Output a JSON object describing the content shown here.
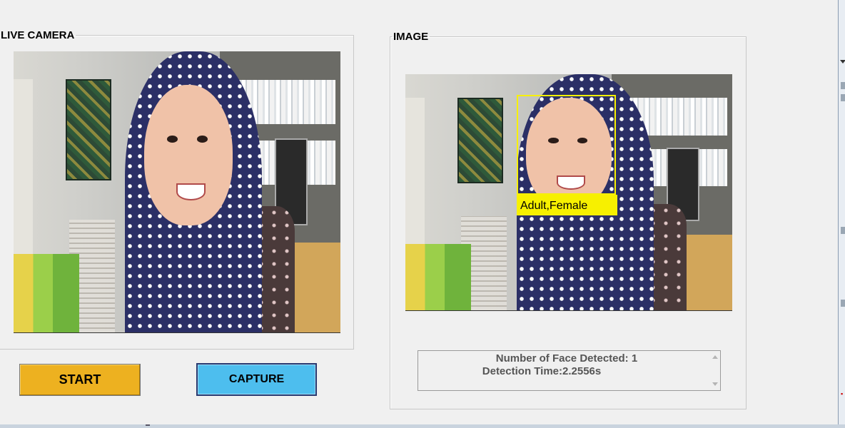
{
  "live_panel": {
    "title": "LIVE CAMERA"
  },
  "image_panel": {
    "title": "IMAGE"
  },
  "detection": {
    "label": "Adult,Female"
  },
  "buttons": {
    "start": "START",
    "capture": "CAPTURE"
  },
  "status": {
    "line1": "Number of Face Detected: 1",
    "line2": "Detection Time:2.2556s"
  },
  "colors": {
    "start_button": "#edb120",
    "capture_button": "#4dbeee",
    "face_box": "#f7f000"
  }
}
